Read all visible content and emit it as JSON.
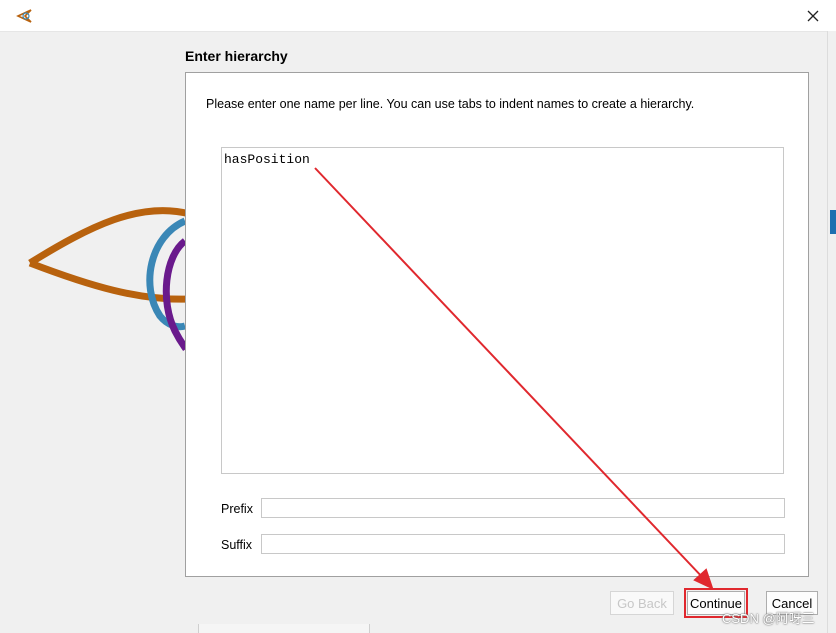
{
  "window": {
    "close_glyph": "✕",
    "icon": "app-logo-icon"
  },
  "dialog": {
    "heading": "Enter hierarchy",
    "instructions": "Please enter one name per line. You can use tabs to indent names to create a hierarchy.",
    "names_value": "hasPosition",
    "prefix_label": "Prefix",
    "prefix_value": "",
    "suffix_label": "Suffix",
    "suffix_value": ""
  },
  "buttons": {
    "go_back": "Go Back",
    "continue": "Continue",
    "cancel": "Cancel"
  },
  "colors": {
    "annotation_red": "#e0282e",
    "logo_orange": "#b8620e",
    "logo_blue": "#3a87b6",
    "logo_purple": "#6a1a8c"
  },
  "watermark": "CSDN @阿呀三"
}
